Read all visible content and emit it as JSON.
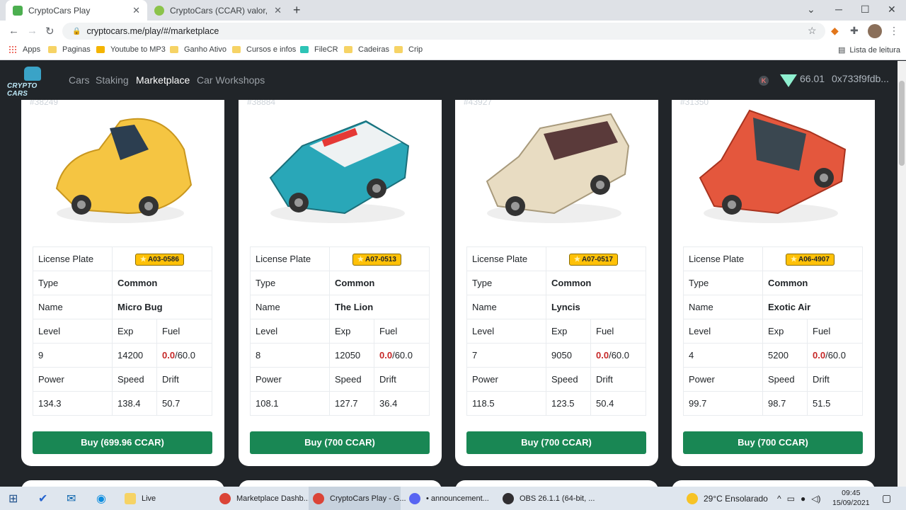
{
  "browser": {
    "tabs": [
      {
        "title": "CryptoCars Play",
        "active": true
      },
      {
        "title": "CryptoCars (CCAR) valor, cotaçã",
        "active": false
      }
    ],
    "url": "cryptocars.me/play/#/marketplace",
    "bookmarks": [
      "Apps",
      "Paginas",
      "Youtube to MP3",
      "Ganho Ativo",
      "Cursos e infos",
      "FileCR",
      "Cadeiras",
      "Crip"
    ],
    "reading_list": "Lista de leitura"
  },
  "header": {
    "logo": "CRYPTO CARS",
    "nav": [
      "Cars",
      "Staking",
      "Marketplace",
      "Car Workshops"
    ],
    "active_nav": "Marketplace",
    "k_badge": "K",
    "balance": "66.01",
    "wallet": "0x733f9fdb..."
  },
  "labels": {
    "license_plate": "License Plate",
    "type": "Type",
    "name": "Name",
    "level": "Level",
    "exp": "Exp",
    "fuel": "Fuel",
    "power": "Power",
    "speed": "Speed",
    "drift": "Drift"
  },
  "cards": [
    {
      "id": "#38249",
      "plate": "A03-0586",
      "type": "Common",
      "name": "Micro Bug",
      "level": "9",
      "exp": "14200",
      "fuel_current": "0.0",
      "fuel_max": "/60.0",
      "power": "134.3",
      "speed": "138.4",
      "drift": "50.7",
      "buy": "Buy (699.96 CCAR)",
      "color": "#f5c542"
    },
    {
      "id": "#38884",
      "plate": "A07-0513",
      "type": "Common",
      "name": "The Lion",
      "level": "8",
      "exp": "12050",
      "fuel_current": "0.0",
      "fuel_max": "/60.0",
      "power": "108.1",
      "speed": "127.7",
      "drift": "36.4",
      "buy": "Buy (700 CCAR)",
      "color": "#29a7b8"
    },
    {
      "id": "#43927",
      "plate": "A07-0517",
      "type": "Common",
      "name": "Lyncis",
      "level": "7",
      "exp": "9050",
      "fuel_current": "0.0",
      "fuel_max": "/60.0",
      "power": "118.5",
      "speed": "123.5",
      "drift": "50.4",
      "buy": "Buy (700 CCAR)",
      "color": "#e8dcc2"
    },
    {
      "id": "#31350",
      "plate": "A06-4907",
      "type": "Common",
      "name": "Exotic Air",
      "level": "4",
      "exp": "5200",
      "fuel_current": "0.0",
      "fuel_max": "/60.0",
      "power": "99.7",
      "speed": "98.7",
      "drift": "51.5",
      "buy": "Buy (700 CCAR)",
      "color": "#e4573d"
    }
  ],
  "taskbar": {
    "items": [
      "Live",
      "Marketplace Dashb...",
      "CryptoCars Play - G...",
      "• announcement...",
      "OBS 26.1.1 (64-bit, ..."
    ],
    "weather": "29°C  Ensolarado",
    "time": "09:45",
    "date": "15/09/2021"
  }
}
